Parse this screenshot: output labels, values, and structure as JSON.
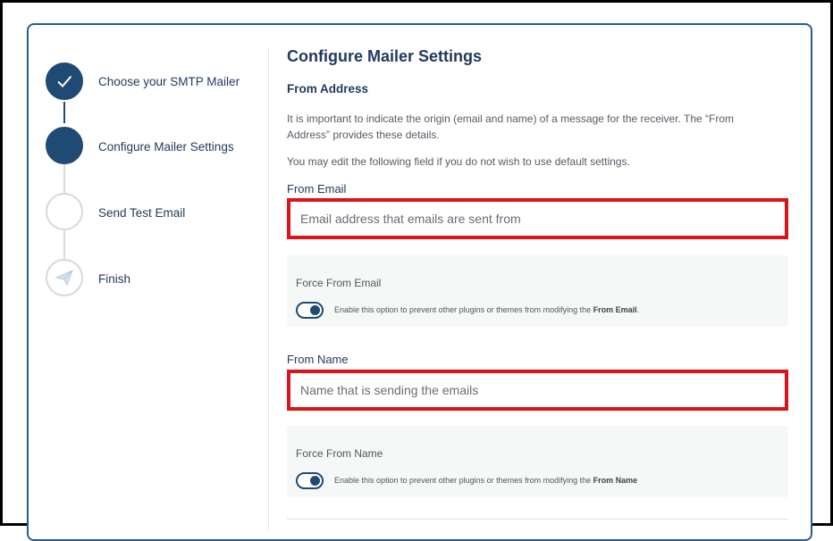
{
  "stepper": {
    "steps": [
      {
        "label": "Choose your SMTP Mailer",
        "state": "done",
        "icon": "checkmark-icon"
      },
      {
        "label": "Configure Mailer Settings",
        "state": "current",
        "icon": ""
      },
      {
        "label": "Send Test Email",
        "state": "pending",
        "icon": ""
      },
      {
        "label": "Finish",
        "state": "pending",
        "icon": "paper-plane-icon"
      }
    ]
  },
  "main": {
    "title": "Configure Mailer Settings",
    "section_title": "From Address",
    "description_1": "It is important to indicate the origin (email and name) of a message for the receiver. The “From Address” provides these details.",
    "description_2": "You may edit the following field if you do not wish to use default settings.",
    "from_email": {
      "label": "From Email",
      "value": "",
      "placeholder": "Email address that emails are sent from"
    },
    "force_from_email": {
      "title": "Force From Email",
      "enabled": true,
      "desc_prefix": "Enable this option to prevent other plugins or themes from modifying the ",
      "desc_bold": "From Email",
      "desc_suffix": "."
    },
    "from_name": {
      "label": "From Name",
      "value": "",
      "placeholder": "Name that is sending the emails"
    },
    "force_from_name": {
      "title": "Force From Name",
      "enabled": true,
      "desc_prefix": "Enable this option to prevent other plugins or themes from modifying the ",
      "desc_bold": "From Name",
      "desc_suffix": ""
    }
  },
  "colors": {
    "primary": "#1f4a73",
    "highlight_border": "#d9141b",
    "card_border": "#2b5b8e"
  }
}
